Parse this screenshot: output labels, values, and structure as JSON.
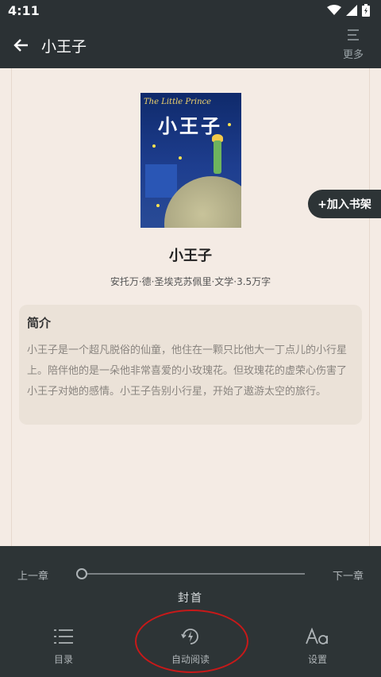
{
  "status": {
    "time": "4:11"
  },
  "header": {
    "title": "小王子",
    "more_label": "更多"
  },
  "book": {
    "cover_en": "The Little Prince",
    "cover_cn": "小王子",
    "title": "小王子",
    "meta": "安托万·德·圣埃克苏佩里·文学·3.5万字",
    "add_to_shelf": "+加入书架"
  },
  "intro": {
    "heading": "简介",
    "text": "小王子是一个超凡脱俗的仙童，他住在一颗只比他大一丁点儿的小行星上。陪伴他的是一朵他非常喜爱的小玫瑰花。但玫瑰花的虚荣心伤害了小王子对她的感情。小王子告别小行星，开始了遨游太空的旅行。"
  },
  "reader_controls": {
    "prev_chapter": "上一章",
    "next_chapter": "下一章",
    "chapter_name": "封首",
    "progress": 0.0
  },
  "menu": {
    "toc": "目录",
    "auto_read": "自动阅读",
    "settings": "设置"
  },
  "colors": {
    "annotation": "#c81919",
    "bar_bg": "#2d3436",
    "page_bg": "#f4ebe4"
  }
}
